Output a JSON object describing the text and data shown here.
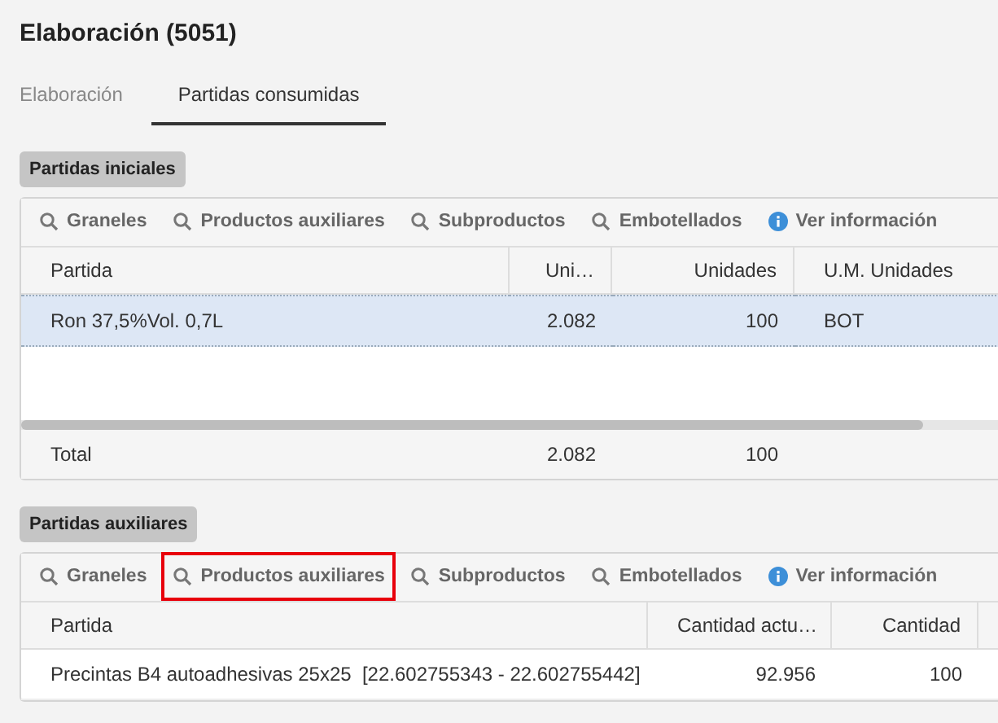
{
  "title": "Elaboración (5051)",
  "tabs": [
    {
      "label": "Elaboración",
      "selected": false
    },
    {
      "label": "Partidas consumidas",
      "selected": true
    }
  ],
  "sections": [
    {
      "heading": "Partidas iniciales",
      "toolbar": [
        {
          "label": "Graneles",
          "kind": "search",
          "highlighted": false
        },
        {
          "label": "Productos auxiliares",
          "kind": "search",
          "highlighted": false
        },
        {
          "label": "Subproductos",
          "kind": "search",
          "highlighted": false
        },
        {
          "label": "Embotellados",
          "kind": "search",
          "highlighted": false
        },
        {
          "label": "Ver información",
          "kind": "info",
          "highlighted": false
        }
      ],
      "columns": [
        {
          "label": "Partida",
          "kind": "text"
        },
        {
          "label": "Uni…",
          "kind": "number"
        },
        {
          "label": "Unidades",
          "kind": "number"
        },
        {
          "label": "U.M. Unidades",
          "kind": "text"
        }
      ],
      "rows": [
        {
          "cells": [
            "Ron 37,5%Vol. 0,7L",
            "2.082",
            "100",
            "BOT"
          ],
          "selected": true
        }
      ],
      "total": [
        "Total",
        "2.082",
        "100"
      ]
    },
    {
      "heading": "Partidas auxiliares",
      "toolbar": [
        {
          "label": "Graneles",
          "kind": "search",
          "highlighted": false
        },
        {
          "label": "Productos auxiliares",
          "kind": "search",
          "highlighted": true
        },
        {
          "label": "Subproductos",
          "kind": "search",
          "highlighted": false
        },
        {
          "label": "Embotellados",
          "kind": "search",
          "highlighted": false
        },
        {
          "label": "Ver información",
          "kind": "info",
          "highlighted": false
        }
      ],
      "columns": [
        {
          "label": "Partida",
          "kind": "text"
        },
        {
          "label": "Cantidad actu…",
          "kind": "number"
        },
        {
          "label": "Cantidad",
          "kind": "number"
        }
      ],
      "rows": [
        {
          "cells": [
            "Precintas B4 autoadhesivas 25x25  [22.602755343 - 22.602755442]",
            "92.956",
            "100"
          ],
          "selected": false
        }
      ]
    }
  ]
}
